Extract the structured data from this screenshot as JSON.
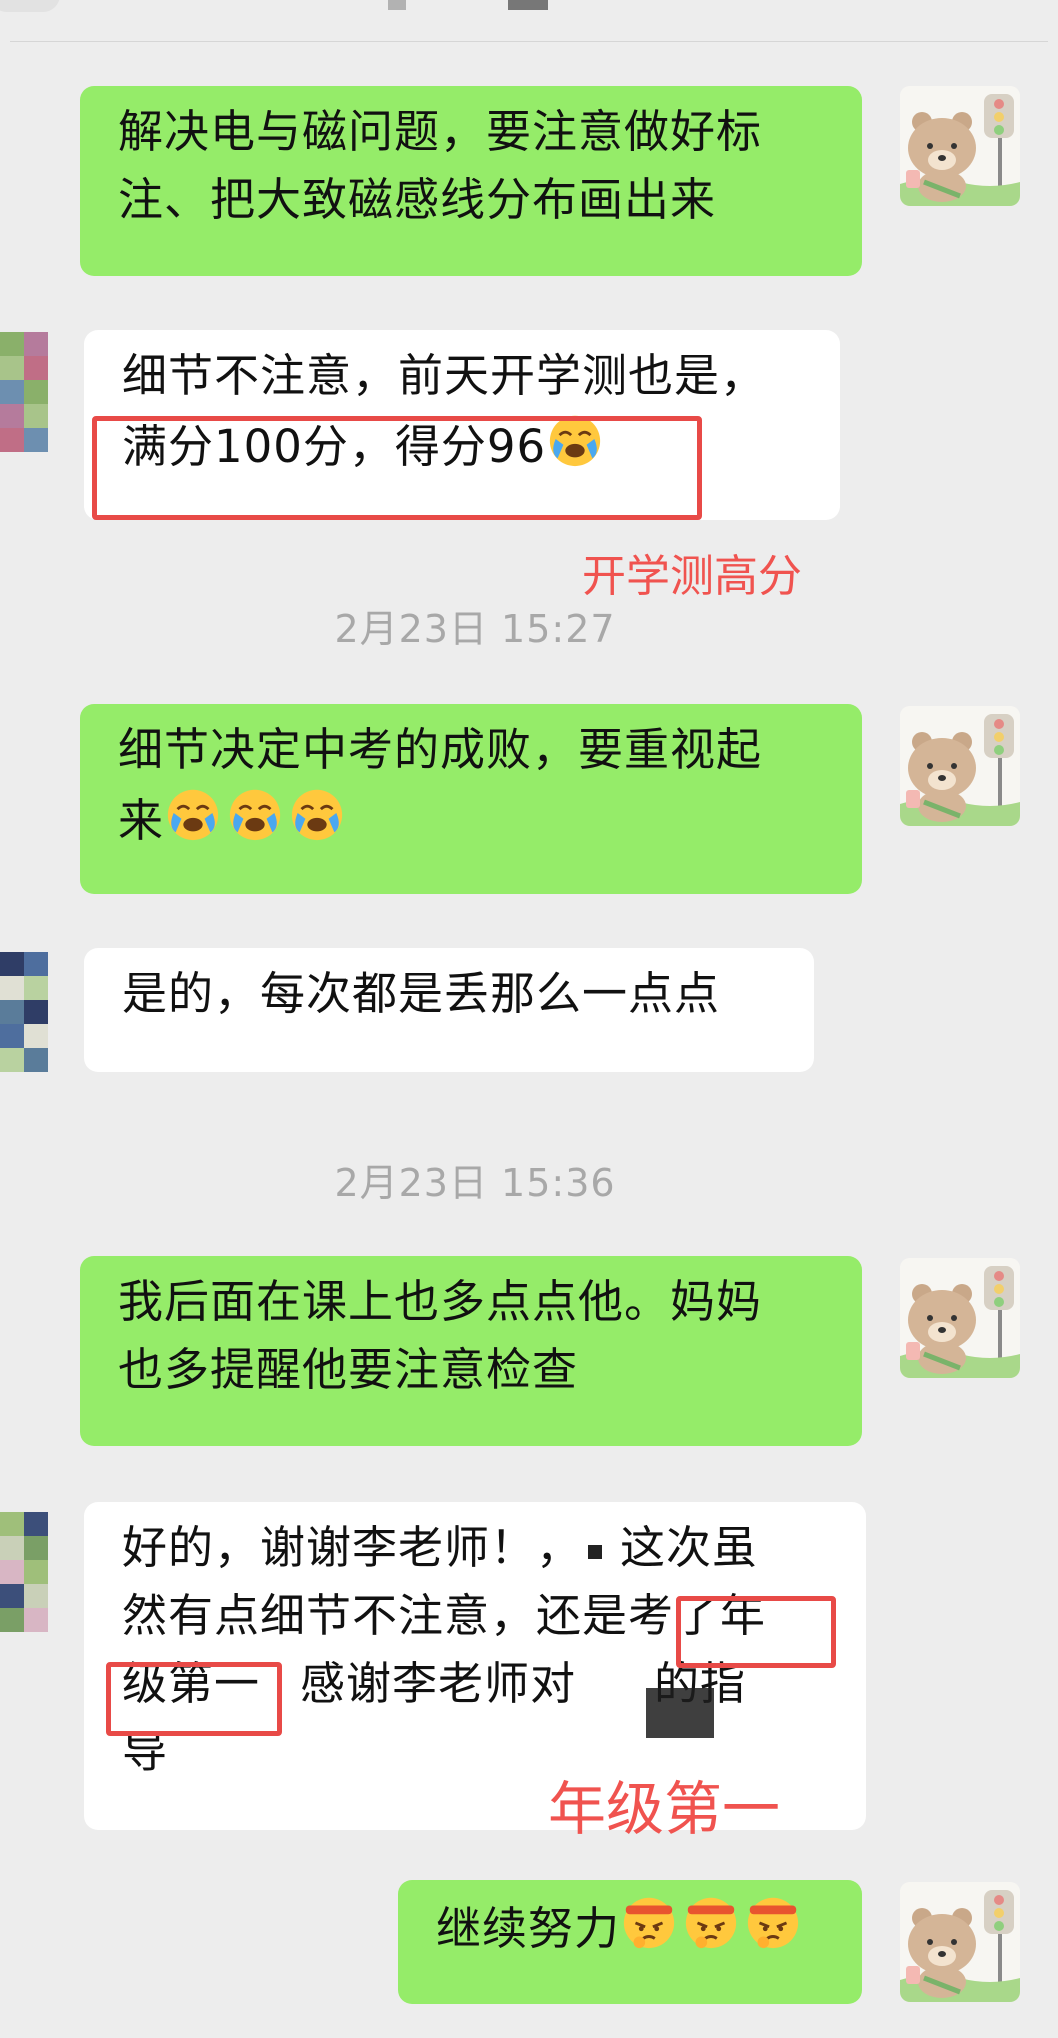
{
  "messages": [
    {
      "lines": [
        "解决电与磁问题，要注意做好标",
        "注、把大致磁感线分布画出来"
      ]
    },
    {
      "lines": [
        "细节不注意，前天开学测也是，",
        "满分100分，得分96"
      ]
    },
    {
      "lines": [
        "细节决定中考的成败，要重视起",
        "来"
      ]
    },
    {
      "lines": [
        "是的，每次都是丢那么一点点"
      ]
    },
    {
      "lines": [
        "我后面在课上也多点点他。妈妈",
        "也多提醒他要注意检查"
      ]
    },
    {
      "lines": [
        "好的，谢谢李老师！，",
        "这次虽",
        "然有点细节不注意，还是考了年",
        "级第一",
        "感谢李老师对",
        "的指",
        "导"
      ]
    },
    {
      "lines": [
        "继续努力"
      ]
    }
  ],
  "timestamps": [
    "2月23日 15:27",
    "2月23日 15:36"
  ],
  "annotations": {
    "note1": "开学测高分",
    "note2": "年级第一"
  },
  "emojis": {
    "crying": "loudly-crying-face",
    "determined": "face-with-headband"
  },
  "colors": {
    "my_bubble": "#95ec69",
    "their_bubble": "#ffffff",
    "highlight": "#e84a47",
    "background": "#ededed"
  }
}
